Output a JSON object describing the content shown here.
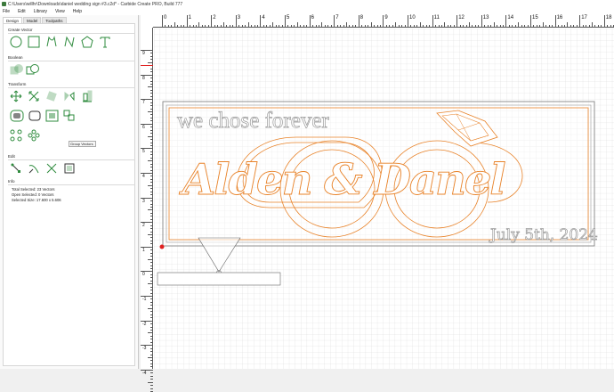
{
  "window": {
    "title": "C:\\Users\\willhr\\Downloads\\daniel wedding sign #3.c2d* - Carbide Create PRO, Build 777"
  },
  "menu": [
    "File",
    "Edit",
    "Library",
    "View",
    "Help"
  ],
  "tabs": [
    "Design",
    "Model",
    "Toolpaths"
  ],
  "sections": {
    "create_vector": "Create Vector",
    "boolean": "Boolean",
    "transform": "Transform",
    "edit": "Edit",
    "info": "Info"
  },
  "tooltip": "Group Vectors",
  "info": {
    "total_selected": "Total Selected:  23 Vectors",
    "open_selected": "Open Selected:   0 Vectors",
    "selected_size": "Selected Size:    17.600 x 5.606"
  },
  "ruler_top": [
    "0",
    "1",
    "2",
    "3",
    "4",
    "5",
    "6",
    "7",
    "8",
    "9",
    "10",
    "11",
    "12",
    "13",
    "14",
    "15",
    "16",
    "17",
    "18"
  ],
  "ruler_left": [
    "9",
    "8",
    "7",
    "6",
    "5",
    "4",
    "3",
    "2",
    "1",
    "0",
    "-1",
    "-2",
    "-3",
    "-4"
  ],
  "design": {
    "tagline": "we chose forever",
    "names": "Alden & Danel",
    "date": "July 5th, 2024"
  },
  "colors": {
    "accent": "#2e8b3d",
    "vector_orange": "#e8832a",
    "text_gray": "#9a9a9a",
    "origin_red": "#e02020"
  }
}
